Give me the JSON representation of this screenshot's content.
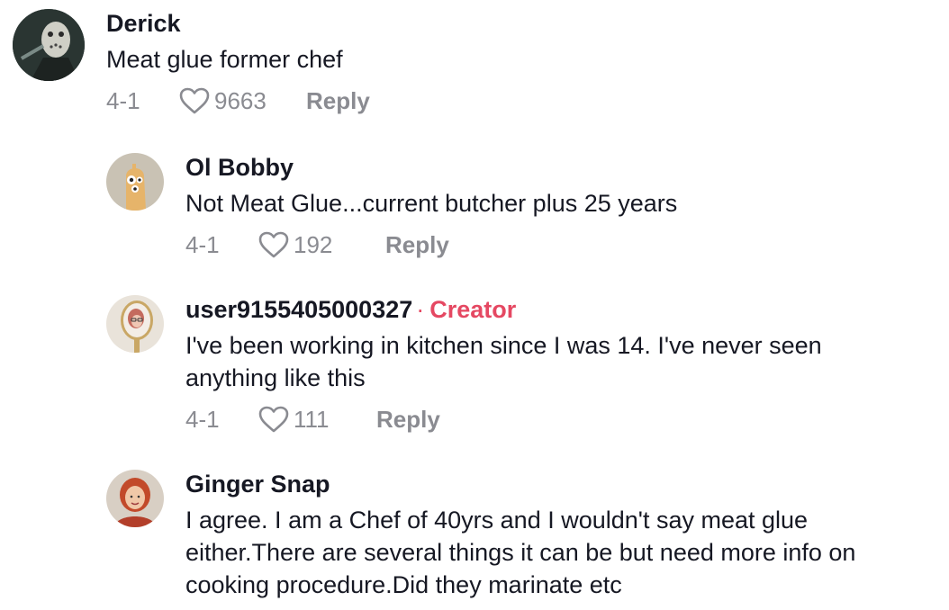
{
  "comments": [
    {
      "author": "Derick",
      "text": "Meat glue former chef",
      "date": "4-1",
      "likes": "9663",
      "reply": "Reply",
      "creator_label": "",
      "avatar_icon": "hockey-mask-avatar"
    },
    {
      "author": "Ol Bobby",
      "text": "Not Meat Glue...current butcher plus 25 years",
      "date": "4-1",
      "likes": "192",
      "reply": "Reply",
      "creator_label": "",
      "avatar_icon": "cartoon-character-avatar"
    },
    {
      "author": "user9155405000327",
      "text": "I've been working in kitchen since I was 14. I've never seen anything like this",
      "date": "4-1",
      "likes": "111",
      "reply": "Reply",
      "creator_label": "Creator",
      "creator_separator": "·",
      "avatar_icon": "mirror-portrait-avatar"
    },
    {
      "author": "Ginger Snap",
      "text": "I agree. I am a Chef of 40yrs and I wouldn't say meat glue either.There are several things it can be but need more info on cooking procedure.Did they marinate etc",
      "date": "",
      "likes": "",
      "reply": "",
      "creator_label": "",
      "avatar_icon": "red-hair-woman-avatar"
    }
  ],
  "colors": {
    "text": "#161823",
    "meta": "#8a8b91",
    "creator": "#e54862"
  }
}
